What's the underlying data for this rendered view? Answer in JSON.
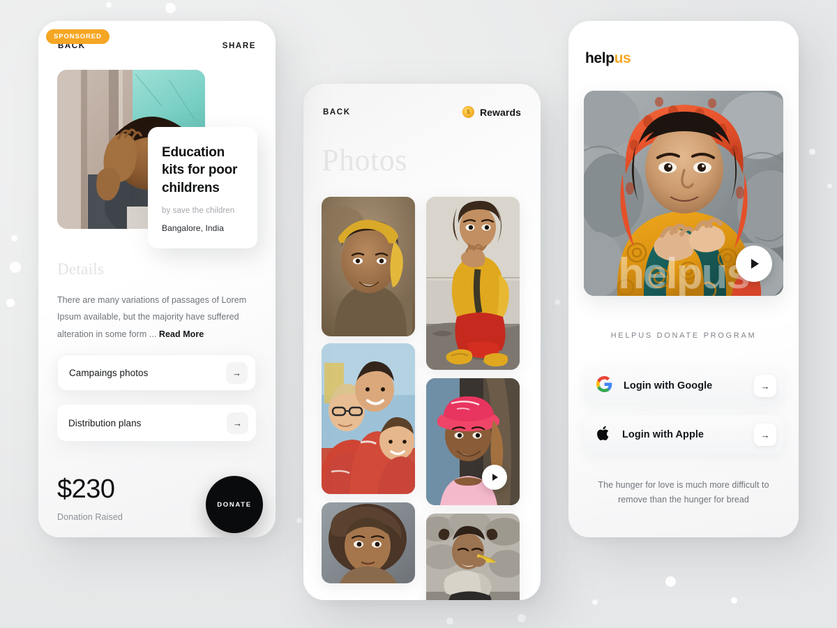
{
  "screen_detail": {
    "nav": {
      "back": "BACK",
      "share": "SHARE"
    },
    "badge": "SPONSORED",
    "card": {
      "title": "Education kits for poor childrens",
      "by": "by save the children",
      "location": "Bangalore, India"
    },
    "details": {
      "heading": "Details",
      "body": "There are many variations of passages of Lorem Ipsum available, but the majority have suffered alteration in some form ... ",
      "read_more": "Read More"
    },
    "rows": [
      {
        "label": "Campaings photos",
        "arrow": "→"
      },
      {
        "label": "Distribution plans",
        "arrow": "→"
      }
    ],
    "donation": {
      "amount": "$230",
      "caption": "Donation Raised",
      "button": "DONATE"
    }
  },
  "screen_photos": {
    "nav": {
      "back": "BACK",
      "rewards": "Rewards",
      "coin_icon": "coin-icon"
    },
    "title": "Photos",
    "grid": [
      {
        "id": "photo-girl-yellow-headscarf",
        "col": "left"
      },
      {
        "id": "photo-girl-yellow-jacket-red-pants",
        "col": "right"
      },
      {
        "id": "photo-boys-red-shirts",
        "col": "left"
      },
      {
        "id": "photo-girl-pink-cap",
        "col": "right",
        "has_play": true
      },
      {
        "id": "photo-girl-curly-hair",
        "col": "left"
      },
      {
        "id": "photo-child-eating-corn",
        "col": "right"
      }
    ]
  },
  "screen_login": {
    "brand": {
      "part1": "help",
      "part2": "us",
      "accent": "#F5A623"
    },
    "hero": {
      "watermark": "helpus",
      "play_icon": "play-icon"
    },
    "program_label": "HELPUS DONATE PROGRAM",
    "providers": [
      {
        "label": "Login with Google",
        "icon": "google-icon",
        "arrow": "→"
      },
      {
        "label": "Login with Apple",
        "icon": "apple-icon",
        "arrow": "→"
      }
    ],
    "quote": "The hunger for love is much more difficult to remove than the hunger for bread"
  },
  "theme": {
    "accent": "#F5A623",
    "ink": "#0c0e10",
    "muted": "#71757b",
    "panel": "#ffffff"
  }
}
